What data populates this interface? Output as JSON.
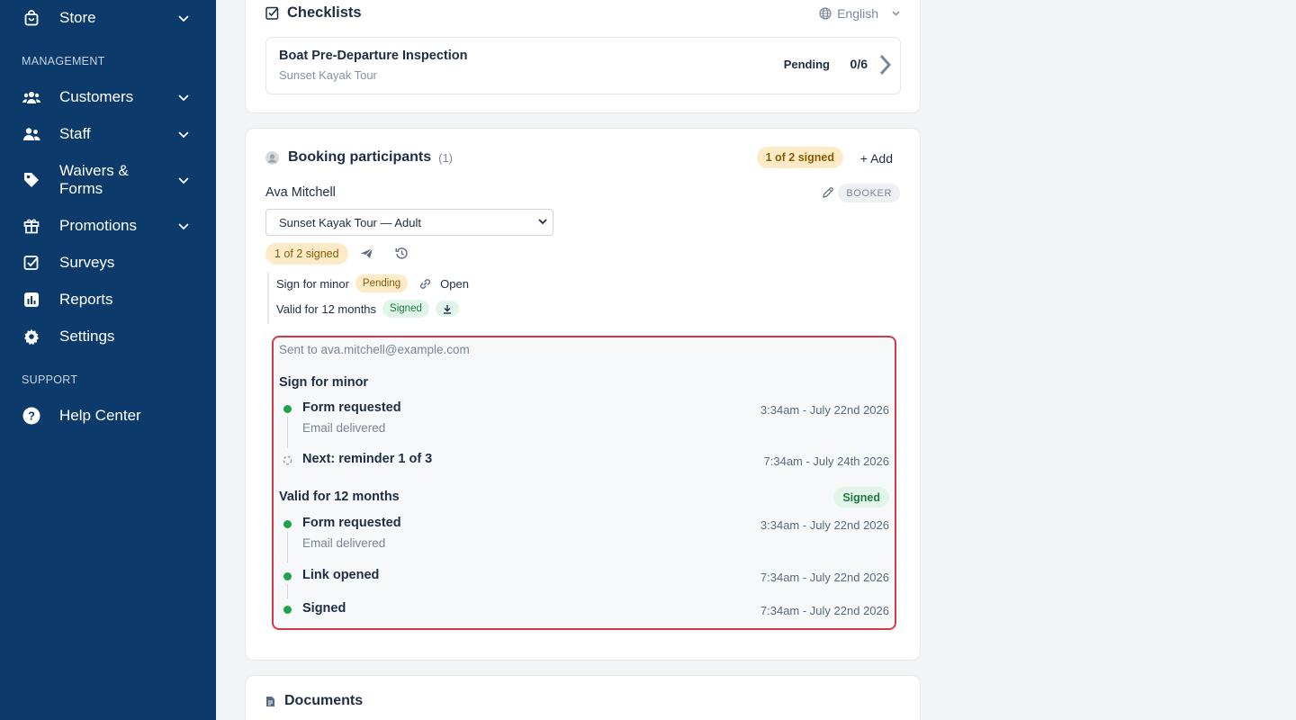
{
  "sidebar": {
    "store": "Store",
    "management_label": "MANAGEMENT",
    "customers": "Customers",
    "staff": "Staff",
    "waivers_line1": "Waivers &",
    "waivers_line2": "Forms",
    "promotions": "Promotions",
    "surveys": "Surveys",
    "reports": "Reports",
    "settings": "Settings",
    "support_label": "SUPPORT",
    "help_center": "Help Center"
  },
  "checklists": {
    "title": "Checklists",
    "language": "English",
    "item_title": "Boat Pre-Departure Inspection",
    "item_subtitle": "Sunset Kayak Tour",
    "status": "Pending",
    "progress": "0/6"
  },
  "participants": {
    "title": "Booking participants",
    "count": "(1)",
    "signed_badge": "1 of 2 signed",
    "add_label": "+ Add",
    "name": "Ava Mitchell",
    "role_badge": "BOOKER",
    "ticket_selected": "Sunset Kayak Tour — Adult",
    "row_signed_badge": "1 of 2 signed",
    "forms": [
      {
        "label": "Sign for minor",
        "status": "Pending",
        "action": "Open"
      },
      {
        "label": "Valid for 12 months",
        "status": "Signed"
      }
    ]
  },
  "activity": {
    "sent_to": "Sent to ava.mitchell@example.com",
    "group1_title": "Sign for minor",
    "g1_e1_title": "Form requested",
    "g1_e1_sub": "Email delivered",
    "g1_e1_time": "3:34am - July 22nd 2026",
    "g1_e2_title": "Next: reminder 1 of 3",
    "g1_e2_time": "7:34am - July 24th 2026",
    "group2_title": "Valid for 12 months",
    "group2_badge": "Signed",
    "g2_e1_title": "Form requested",
    "g2_e1_sub": "Email delivered",
    "g2_e1_time": "3:34am - July 22nd 2026",
    "g2_e2_title": "Link opened",
    "g2_e2_time": "7:34am - July 22nd 2026",
    "g2_e3_title": "Signed",
    "g2_e3_time": "7:34am - July 22nd 2026"
  },
  "documents": {
    "title": "Documents"
  },
  "colors": {
    "sidebar": "#0c3a6b",
    "highlight": "#d13a4a",
    "success": "#22a04b",
    "warn": "#fdebc8"
  }
}
